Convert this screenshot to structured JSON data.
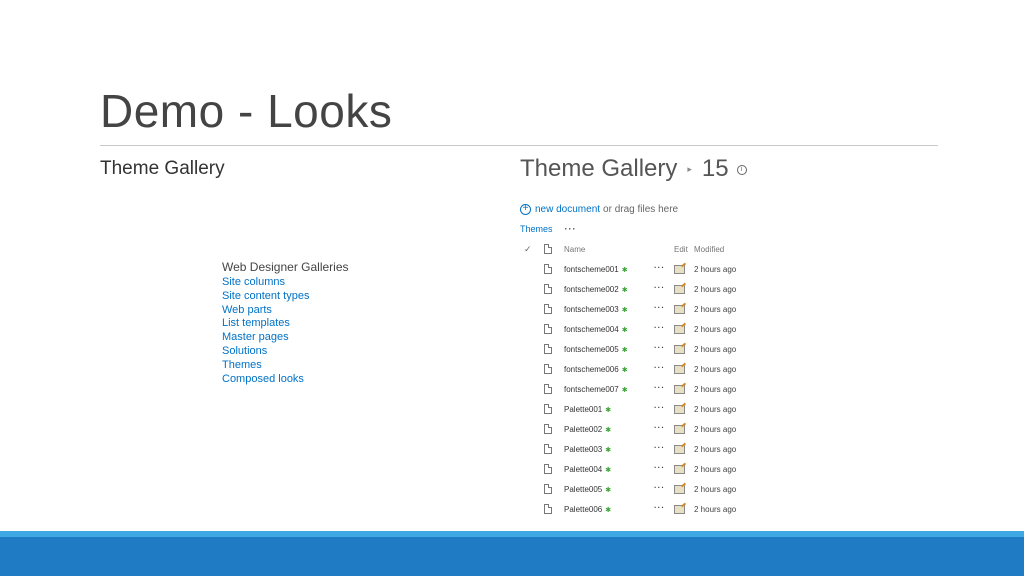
{
  "slide": {
    "title": "Demo - Looks",
    "subtitle": "Theme Gallery"
  },
  "galleries": {
    "heading": "Web Designer Galleries",
    "links": [
      "Site columns",
      "Site content types",
      "Web parts",
      "List templates",
      "Master pages",
      "Solutions",
      "Themes",
      "Composed looks"
    ]
  },
  "library": {
    "title": "Theme Gallery",
    "folder": "15",
    "new_document": "new document",
    "drag_text": "or drag files here",
    "view": "Themes",
    "view_more": "···",
    "headers": {
      "check": "✓",
      "name": "Name",
      "edit": "Edit",
      "modified": "Modified"
    },
    "rows": [
      {
        "name": "fontscheme001",
        "modified": "2 hours ago"
      },
      {
        "name": "fontscheme002",
        "modified": "2 hours ago"
      },
      {
        "name": "fontscheme003",
        "modified": "2 hours ago"
      },
      {
        "name": "fontscheme004",
        "modified": "2 hours ago"
      },
      {
        "name": "fontscheme005",
        "modified": "2 hours ago"
      },
      {
        "name": "fontscheme006",
        "modified": "2 hours ago"
      },
      {
        "name": "fontscheme007",
        "modified": "2 hours ago"
      },
      {
        "name": "Palette001",
        "modified": "2 hours ago"
      },
      {
        "name": "Palette002",
        "modified": "2 hours ago"
      },
      {
        "name": "Palette003",
        "modified": "2 hours ago"
      },
      {
        "name": "Palette004",
        "modified": "2 hours ago"
      },
      {
        "name": "Palette005",
        "modified": "2 hours ago"
      },
      {
        "name": "Palette006",
        "modified": "2 hours ago"
      }
    ],
    "new_badge": "✱",
    "row_dots": "···"
  },
  "colors": {
    "link": "#0072c6",
    "footer": "#1f7bc4",
    "footer_accent": "#3fa9e4",
    "new_badge": "#3aa335"
  }
}
